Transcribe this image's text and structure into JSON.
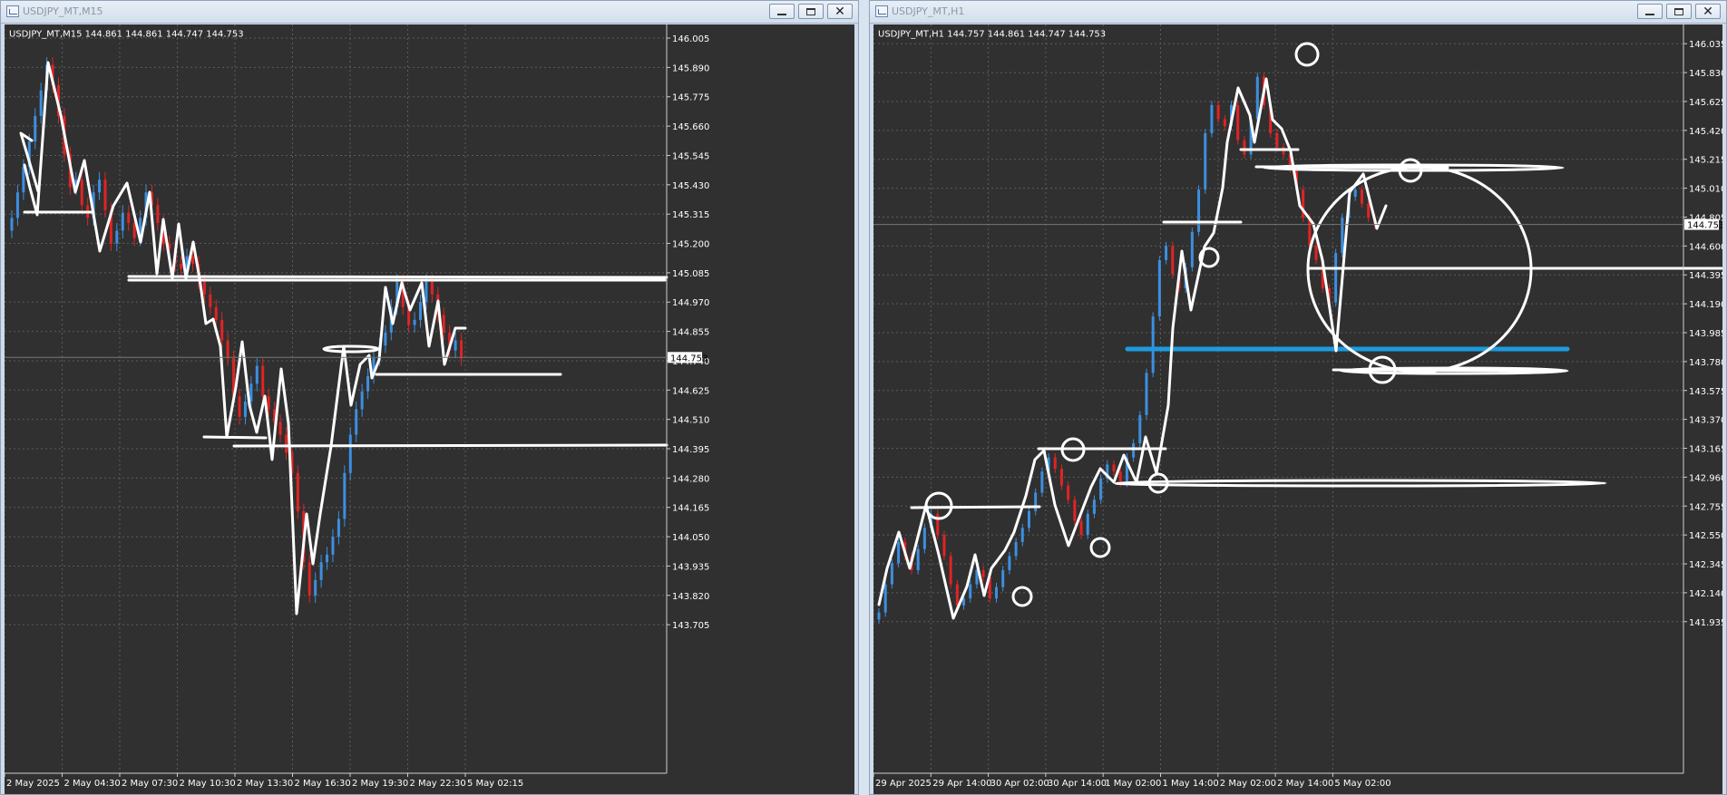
{
  "windows": {
    "left": {
      "title": "USDJPY_MT,M15",
      "info": "USDJPY_MT,M15  144.861 144.861 144.747 144.753",
      "price_labels": [
        "146.005",
        "145.890",
        "145.775",
        "145.660",
        "145.545",
        "145.430",
        "145.315",
        "145.200",
        "145.085",
        "144.970",
        "144.855",
        "144.740",
        "144.625",
        "144.510",
        "144.395",
        "144.280",
        "144.165",
        "144.050",
        "143.935",
        "143.820",
        "143.705"
      ],
      "current_price": "144.753",
      "time_labels": [
        "2 May 2025",
        "2 May 04:30",
        "2 May 07:30",
        "2 May 10:30",
        "2 May 13:30",
        "2 May 16:30",
        "2 May 19:30",
        "2 May 22:30",
        "5 May 02:15"
      ]
    },
    "right": {
      "title": "USDJPY_MT,H1",
      "info": "USDJPY_MT,H1  144.757 144.861 144.747 144.753",
      "price_labels": [
        "146.035",
        "145.830",
        "145.625",
        "145.420",
        "145.215",
        "145.010",
        "144.805",
        "144.600",
        "144.395",
        "144.190",
        "143.985",
        "143.780",
        "143.575",
        "143.370",
        "143.165",
        "142.960",
        "142.755",
        "142.550",
        "142.345",
        "142.140",
        "141.935"
      ],
      "current_price": "144.753",
      "time_labels": [
        "29 Apr 2025",
        "29 Apr 14:00",
        "30 Apr 02:00",
        "30 Apr 14:00",
        "1 May 02:00",
        "1 May 14:00",
        "2 May 02:00",
        "2 May 14:00",
        "5 May 02:00"
      ]
    }
  },
  "colors": {
    "bull": "#3d8fe0",
    "bear": "#e02424",
    "background": "#303030",
    "grid": "#5c5c5c",
    "drawing": "#ffffff",
    "support_line": "#1e9be0"
  },
  "icons": {
    "app": "chart-window-icon",
    "minimize": "minimize-icon",
    "maximize": "maximize-icon",
    "close": "close-icon"
  },
  "chart_data": [
    {
      "type": "candlestick",
      "symbol": "USDJPY_MT",
      "timeframe": "M15",
      "ylim": [
        143.67,
        146.03
      ],
      "closes": [
        145.3,
        145.4,
        145.5,
        145.6,
        145.7,
        145.8,
        145.9,
        145.82,
        145.7,
        145.55,
        145.42,
        145.45,
        145.35,
        145.3,
        145.4,
        145.45,
        145.33,
        145.2,
        145.25,
        145.32,
        145.28,
        145.22,
        145.3,
        145.4,
        145.35,
        145.28,
        145.2,
        145.18,
        145.12,
        145.1,
        145.15,
        145.12,
        145.05,
        145.0,
        144.95,
        144.9,
        144.82,
        144.75,
        144.6,
        144.52,
        144.58,
        144.65,
        144.72,
        144.6,
        144.55,
        144.5,
        144.45,
        144.38,
        144.3,
        144.15,
        143.95,
        143.82,
        143.88,
        143.95,
        143.98,
        144.05,
        144.12,
        144.3,
        144.45,
        144.55,
        144.62,
        144.68,
        144.75,
        144.8,
        144.85,
        144.95,
        145.05,
        144.95,
        144.88,
        144.9,
        144.97,
        145.05,
        145.0,
        144.92,
        144.85,
        144.78,
        144.82,
        144.75
      ],
      "current_price": 144.753
    },
    {
      "type": "candlestick",
      "symbol": "USDJPY_MT",
      "timeframe": "H1",
      "ylim": [
        141.85,
        146.12
      ],
      "closes": [
        142.0,
        142.2,
        142.35,
        142.5,
        142.4,
        142.3,
        142.45,
        142.6,
        142.7,
        142.55,
        142.4,
        142.2,
        142.05,
        142.1,
        142.2,
        142.3,
        142.25,
        142.1,
        142.18,
        142.3,
        142.4,
        142.5,
        142.6,
        142.72,
        142.85,
        143.0,
        143.1,
        143.02,
        142.9,
        142.8,
        142.65,
        142.55,
        142.7,
        142.8,
        142.95,
        143.05,
        143.0,
        142.92,
        143.1,
        143.2,
        143.4,
        143.7,
        144.1,
        144.5,
        144.6,
        144.4,
        144.3,
        144.45,
        144.7,
        145.0,
        145.4,
        145.6,
        145.5,
        145.45,
        145.6,
        145.35,
        145.25,
        145.5,
        145.8,
        145.6,
        145.4,
        145.3,
        145.25,
        145.15,
        145.0,
        144.8,
        144.6,
        144.5,
        144.3,
        144.2,
        144.55,
        144.8,
        144.95,
        145.0,
        144.9,
        144.8,
        144.75
      ],
      "current_price": 144.753,
      "support_level": 143.84
    }
  ]
}
